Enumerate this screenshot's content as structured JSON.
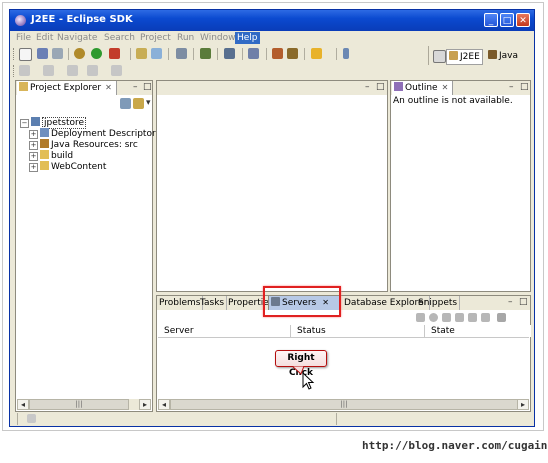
{
  "window": {
    "title": "J2EE - Eclipse SDK"
  },
  "menu": [
    "File",
    "Edit",
    "Navigate",
    "Search",
    "Project",
    "Run",
    "Window",
    "Help"
  ],
  "perspectives": {
    "active": "J2EE",
    "other": "Java"
  },
  "project_explorer": {
    "title": "Project Explorer",
    "tree": {
      "root": "jpetstore",
      "children": [
        "Deployment Descriptor",
        "Java Resources: src",
        "build",
        "WebContent"
      ]
    }
  },
  "outline": {
    "title": "Outline",
    "message": "An outline is not available."
  },
  "bottom_panel": {
    "tabs": [
      "Problems",
      "Tasks",
      "Properties",
      "Servers",
      "Database Explorer",
      "Snippets"
    ],
    "selected_tab": "Servers",
    "columns": [
      "Server",
      "Status",
      "State"
    ]
  },
  "annotation": {
    "callout": "Right Click"
  },
  "watermark": "http://blog.naver.com/cugain",
  "colors": {
    "title_bar": "#0b4ad0",
    "highlight": "#e02020",
    "selected_tab": "#b7c9e6"
  }
}
